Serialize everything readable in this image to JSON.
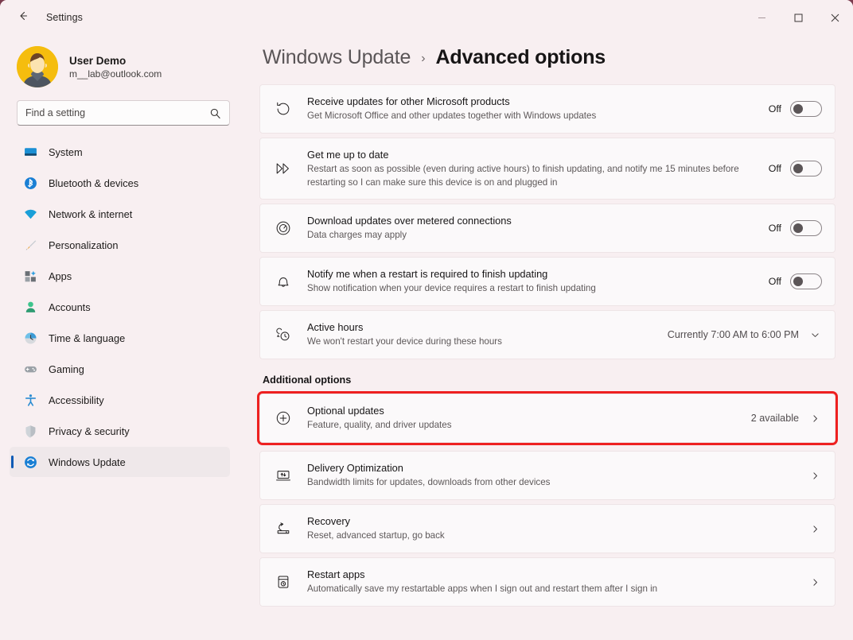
{
  "window": {
    "title": "Settings",
    "back_icon": "back-arrow-icon",
    "minimize_label": "—",
    "maximize_label": "□",
    "close_label": "✕"
  },
  "account": {
    "name": "User Demo",
    "email": "m__lab@outlook.com",
    "avatar_bg": "#f5bd0e"
  },
  "search": {
    "placeholder": "Find a setting",
    "value": "",
    "icon": "search-icon"
  },
  "sidebar": {
    "accent": "#0f5bb5",
    "items": [
      {
        "label": "System",
        "icon": "monitor-icon",
        "selected": false
      },
      {
        "label": "Bluetooth & devices",
        "icon": "bluetooth-icon",
        "selected": false
      },
      {
        "label": "Network & internet",
        "icon": "wifi-icon",
        "selected": false
      },
      {
        "label": "Personalization",
        "icon": "paintbrush-icon",
        "selected": false
      },
      {
        "label": "Apps",
        "icon": "apps-grid-icon",
        "selected": false
      },
      {
        "label": "Accounts",
        "icon": "person-icon",
        "selected": false
      },
      {
        "label": "Time & language",
        "icon": "clock-globe-icon",
        "selected": false
      },
      {
        "label": "Gaming",
        "icon": "gamepad-icon",
        "selected": false
      },
      {
        "label": "Accessibility",
        "icon": "accessibility-person-icon",
        "selected": false
      },
      {
        "label": "Privacy & security",
        "icon": "shield-icon",
        "selected": false
      },
      {
        "label": "Windows Update",
        "icon": "windows-update-icon",
        "selected": true
      }
    ]
  },
  "header": {
    "parent": "Windows Update",
    "separator": "›",
    "current": "Advanced options"
  },
  "settings": [
    {
      "title": "Receive updates for other Microsoft products",
      "subtitle": "Get Microsoft Office and other updates together with Windows updates",
      "icon": "refresh-history-icon",
      "control": "toggle",
      "state": "Off"
    },
    {
      "title": "Get me up to date",
      "subtitle": "Restart as soon as possible (even during active hours) to finish updating, and notify me 15 minutes before restarting so I can make sure this device is on and plugged in",
      "icon": "fast-forward-icon",
      "control": "toggle",
      "state": "Off"
    },
    {
      "title": "Download updates over metered connections",
      "subtitle": "Data charges may apply",
      "icon": "gauge-icon",
      "control": "toggle",
      "state": "Off"
    },
    {
      "title": "Notify me when a restart is required to finish updating",
      "subtitle": "Show notification when your device requires a restart to finish updating",
      "icon": "bell-icon",
      "control": "toggle",
      "state": "Off"
    },
    {
      "title": "Active hours",
      "subtitle": "We won't restart your device during these hours",
      "icon": "active-hours-clock-icon",
      "control": "expander",
      "value": "Currently 7:00 AM to 6:00 PM"
    }
  ],
  "additional": {
    "heading": "Additional options",
    "highlight_color": "#ee2020",
    "items": [
      {
        "title": "Optional updates",
        "subtitle": "Feature, quality, and driver updates",
        "icon": "plus-circle-icon",
        "value": "2 available",
        "highlighted": true
      },
      {
        "title": "Delivery Optimization",
        "subtitle": "Bandwidth limits for updates, downloads from other devices",
        "icon": "delivery-optimization-icon",
        "value": "",
        "highlighted": false
      },
      {
        "title": "Recovery",
        "subtitle": "Reset, advanced startup, go back",
        "icon": "recovery-icon",
        "value": "",
        "highlighted": false
      },
      {
        "title": "Restart apps",
        "subtitle": "Automatically save my restartable apps when I sign out and restart them after I sign in",
        "icon": "restart-apps-icon",
        "value": "",
        "highlighted": false
      }
    ]
  }
}
